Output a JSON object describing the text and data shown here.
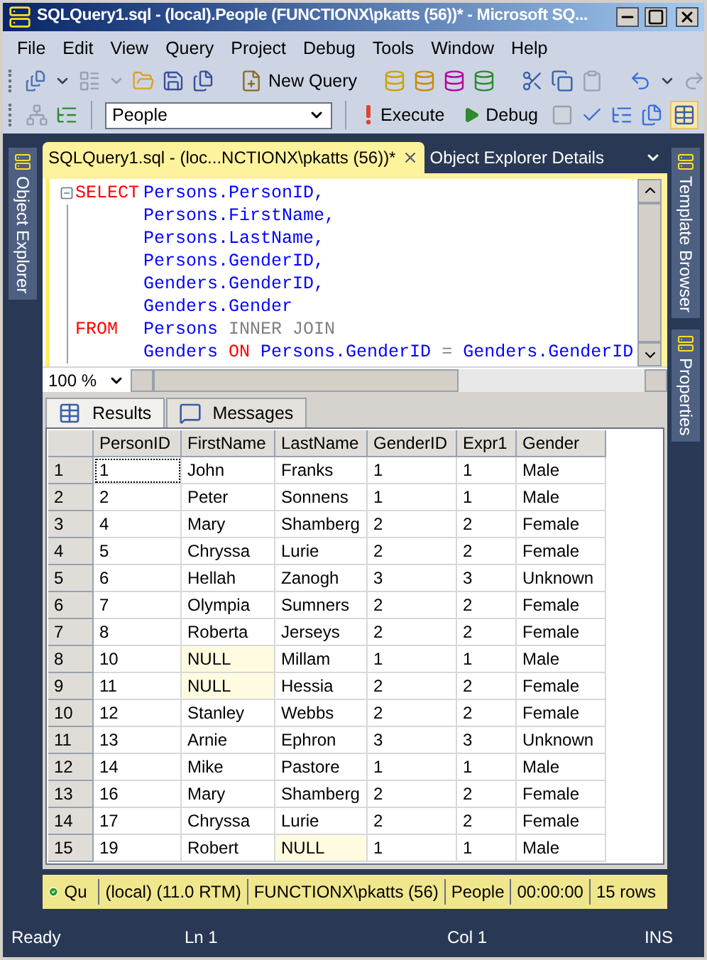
{
  "window": {
    "title": "SQLQuery1.sql - (local).People (FUNCTIONX\\pkatts (56))* - Microsoft SQ..."
  },
  "menu": [
    "File",
    "Edit",
    "View",
    "Query",
    "Project",
    "Debug",
    "Tools",
    "Window",
    "Help"
  ],
  "toolbar": {
    "new_query": "New Query",
    "database": "People",
    "execute": "Execute",
    "debug": "Debug",
    "results_to_grid": {
      "selected": true
    }
  },
  "side_panels": {
    "left": [
      "Object Explorer"
    ],
    "right": [
      "Template Browser",
      "Properties"
    ]
  },
  "document_tabs": [
    {
      "label": "SQLQuery1.sql - (loc...NCTIONX\\pkatts (56))*",
      "selected": true
    },
    {
      "label": "Object Explorer Details",
      "selected": false
    }
  ],
  "editor": {
    "zoom": "100 %",
    "lines": [
      {
        "keyword": "SELECT",
        "parts": [
          {
            "text": "Persons.PersonID,",
            "kind": "name"
          }
        ]
      },
      {
        "parts": [
          {
            "text": "Persons.FirstName,",
            "kind": "name"
          }
        ]
      },
      {
        "parts": [
          {
            "text": "Persons.LastName,",
            "kind": "name"
          }
        ]
      },
      {
        "parts": [
          {
            "text": "Persons.GenderID,",
            "kind": "name"
          }
        ]
      },
      {
        "parts": [
          {
            "text": "Genders.GenderID,",
            "kind": "name"
          }
        ]
      },
      {
        "parts": [
          {
            "text": "Genders.Gender",
            "kind": "name"
          }
        ]
      },
      {
        "keyword": "FROM",
        "parts": [
          {
            "text": "Persons",
            "kind": "name"
          },
          {
            "text": "INNER JOIN",
            "kind": "operator"
          }
        ]
      },
      {
        "parts": [
          {
            "text": "Genders",
            "kind": "name"
          },
          {
            "text": "ON",
            "kind": "keyword"
          },
          {
            "text": "Persons.GenderID",
            "kind": "name"
          },
          {
            "text": "=",
            "kind": "operator"
          },
          {
            "text": "Genders.GenderID",
            "kind": "name"
          }
        ]
      }
    ]
  },
  "result_tabs": [
    {
      "label": "Results",
      "selected": true
    },
    {
      "label": "Messages",
      "selected": false
    }
  ],
  "grid": {
    "columns": [
      "PersonID",
      "FirstName",
      "LastName",
      "GenderID",
      "Expr1",
      "Gender"
    ],
    "rows": [
      {
        "number": "1",
        "selected": true,
        "cells": [
          "1",
          "John",
          "Franks",
          "1",
          "1",
          "Male"
        ],
        "null": [
          false,
          false,
          false,
          false,
          false,
          false
        ]
      },
      {
        "number": "2",
        "selected": false,
        "cells": [
          "2",
          "Peter",
          "Sonnens",
          "1",
          "1",
          "Male"
        ],
        "null": [
          false,
          false,
          false,
          false,
          false,
          false
        ]
      },
      {
        "number": "3",
        "selected": false,
        "cells": [
          "4",
          "Mary",
          "Shamberg",
          "2",
          "2",
          "Female"
        ],
        "null": [
          false,
          false,
          false,
          false,
          false,
          false
        ]
      },
      {
        "number": "4",
        "selected": false,
        "cells": [
          "5",
          "Chryssa",
          "Lurie",
          "2",
          "2",
          "Female"
        ],
        "null": [
          false,
          false,
          false,
          false,
          false,
          false
        ]
      },
      {
        "number": "5",
        "selected": false,
        "cells": [
          "6",
          "Hellah",
          "Zanogh",
          "3",
          "3",
          "Unknown"
        ],
        "null": [
          false,
          false,
          false,
          false,
          false,
          false
        ]
      },
      {
        "number": "6",
        "selected": false,
        "cells": [
          "7",
          "Olympia",
          "Sumners",
          "2",
          "2",
          "Female"
        ],
        "null": [
          false,
          false,
          false,
          false,
          false,
          false
        ]
      },
      {
        "number": "7",
        "selected": false,
        "cells": [
          "8",
          "Roberta",
          "Jerseys",
          "2",
          "2",
          "Female"
        ],
        "null": [
          false,
          false,
          false,
          false,
          false,
          false
        ]
      },
      {
        "number": "8",
        "selected": false,
        "cells": [
          "10",
          "NULL",
          "Millam",
          "1",
          "1",
          "Male"
        ],
        "null": [
          false,
          true,
          false,
          false,
          false,
          false
        ]
      },
      {
        "number": "9",
        "selected": false,
        "cells": [
          "11",
          "NULL",
          "Hessia",
          "2",
          "2",
          "Female"
        ],
        "null": [
          false,
          true,
          false,
          false,
          false,
          false
        ]
      },
      {
        "number": "10",
        "selected": false,
        "cells": [
          "12",
          "Stanley",
          "Webbs",
          "2",
          "2",
          "Female"
        ],
        "null": [
          false,
          false,
          false,
          false,
          false,
          false
        ]
      },
      {
        "number": "11",
        "selected": false,
        "cells": [
          "13",
          "Arnie",
          "Ephron",
          "3",
          "3",
          "Unknown"
        ],
        "null": [
          false,
          false,
          false,
          false,
          false,
          false
        ]
      },
      {
        "number": "12",
        "selected": false,
        "cells": [
          "14",
          "Mike",
          "Pastore",
          "1",
          "1",
          "Male"
        ],
        "null": [
          false,
          false,
          false,
          false,
          false,
          false
        ]
      },
      {
        "number": "13",
        "selected": false,
        "cells": [
          "16",
          "Mary",
          "Shamberg",
          "2",
          "2",
          "Female"
        ],
        "null": [
          false,
          false,
          false,
          false,
          false,
          false
        ]
      },
      {
        "number": "14",
        "selected": false,
        "cells": [
          "17",
          "Chryssa",
          "Lurie",
          "2",
          "2",
          "Female"
        ],
        "null": [
          false,
          false,
          false,
          false,
          false,
          false
        ]
      },
      {
        "number": "15",
        "selected": false,
        "cells": [
          "19",
          "Robert",
          "NULL",
          "1",
          "1",
          "Male"
        ],
        "null": [
          false,
          false,
          true,
          false,
          false,
          false
        ]
      }
    ]
  },
  "query_status": {
    "message": "Qu",
    "server": "(local) (11.0 RTM)",
    "user": "FUNCTIONX\\pkatts (56)",
    "database": "People",
    "elapsed": "00:00:00",
    "rows": "15 rows"
  },
  "status_bar": {
    "state": "Ready",
    "line": "Ln 1",
    "column": "Col 1",
    "mode": "INS"
  }
}
